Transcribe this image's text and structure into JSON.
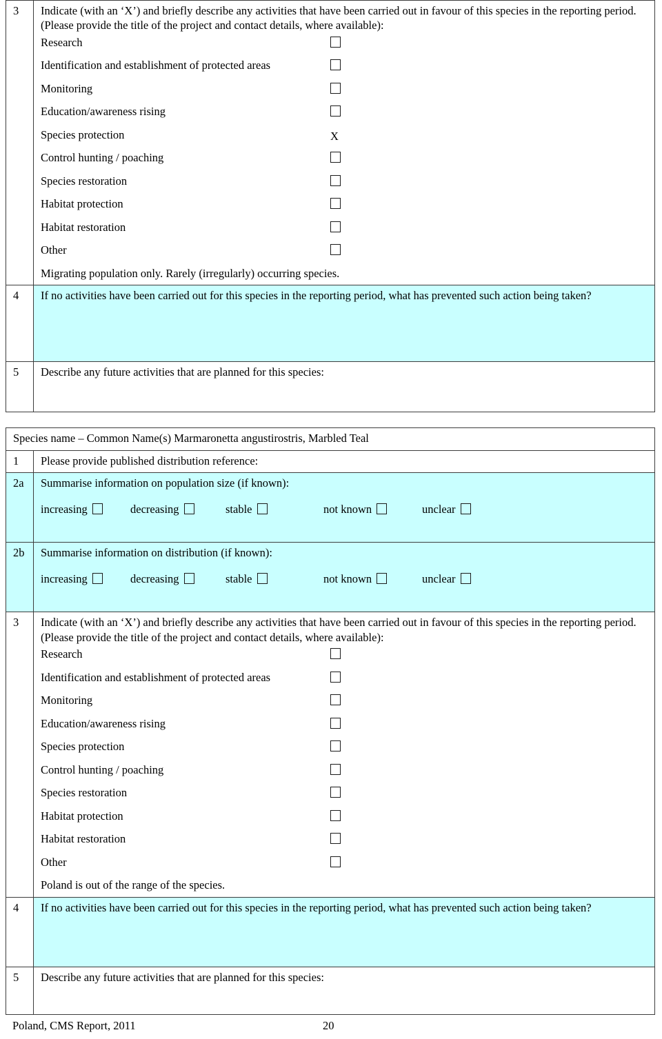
{
  "document": {
    "footer_left": "Poland, CMS Report, 2011",
    "footer_page": "20",
    "colors": {
      "highlight": "#c9ffff",
      "border": "#3c3c3c",
      "text": "#000000"
    }
  },
  "labels": {
    "activity_items": [
      "Research",
      "Identification and establishment of protected areas",
      "Monitoring",
      "Education/awareness rising",
      "Species protection",
      "Control hunting / poaching",
      "Species restoration",
      "Habitat protection",
      "Habitat restoration",
      "Other"
    ],
    "trend_options": [
      "increasing",
      "decreasing",
      "stable",
      "not known",
      "unclear"
    ],
    "questions": {
      "q3": "Indicate (with an ‘X’) and briefly describe any activities that have been carried out in favour of this species in the reporting period.  (Please provide the title of the project and contact details, where available):",
      "q4": "If no activities have been carried out for this species in the reporting period, what has prevented such action being taken?",
      "q5": "Describe any future activities that are planned for this species:",
      "q1": "Please provide published distribution reference:",
      "q2a": "Summarise information on population size (if known):",
      "q2b": "Summarise information on distribution (if known):"
    },
    "numbers": {
      "n1": "1",
      "n2a": "2a",
      "n2b": "2b",
      "n3": "3",
      "n4": "4",
      "n5": "5"
    }
  },
  "section_top": {
    "q3_number": "3",
    "q3_text": "Indicate (with an ‘X’) and briefly describe any activities that have been carried out in favour of this species in the reporting period.  (Please provide the title of the project and contact details, where available):",
    "marks": [
      "box",
      "box",
      "box",
      "box",
      "X",
      "box",
      "box",
      "box",
      "box",
      "box"
    ],
    "note": "Migrating population only. Rarely (irregularly) occurring species.",
    "q4_number": "4",
    "q4_text": "If no activities have been carried out for this species in the reporting period, what has prevented such action being taken?",
    "q5_number": "5",
    "q5_text": "Describe any future activities that are planned for this species:"
  },
  "section_bottom": {
    "species_header": "Species name – Common Name(s)  Marmaronetta angustirostris, Marbled Teal",
    "q1_number": "1",
    "q1_text": "Please provide published distribution reference:",
    "q2a_number": "2a",
    "q2a_text": "Summarise information on population size (if known):",
    "q2b_number": "2b",
    "q2b_text": "Summarise information on distribution (if known):",
    "trend_options": [
      "increasing",
      "decreasing",
      "stable",
      "not known",
      "unclear"
    ],
    "q3_number": "3",
    "q3_text": "Indicate (with an ‘X’) and briefly describe any activities that have been carried out in favour of this species in the reporting period.  (Please provide the title of the project and contact details, where available):",
    "marks": [
      "box",
      "box",
      "box",
      "box",
      "box",
      "box",
      "box",
      "box",
      "box",
      "box"
    ],
    "note": "Poland is out of the range of the species.",
    "q4_number": "4",
    "q4_text": "If no activities have been carried out for this species in the reporting period, what has prevented such action being taken?",
    "q5_number": "5",
    "q5_text": "Describe any future activities that are planned for this species:"
  }
}
